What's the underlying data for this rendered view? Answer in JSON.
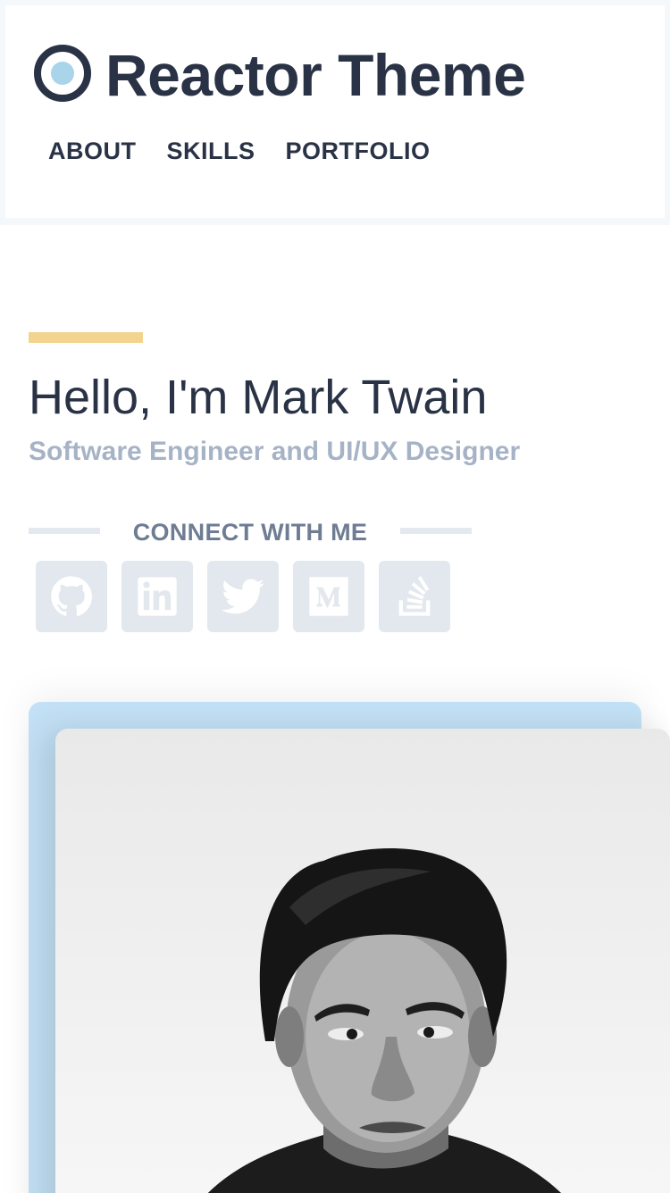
{
  "header": {
    "logo_text": "Reactor Theme",
    "logo_icon": "ring-logo-icon",
    "nav": [
      "ABOUT",
      "SKILLS",
      "PORTFOLIO"
    ]
  },
  "hero": {
    "greeting": "Hello, I'm Mark Twain",
    "subtitle": "Software Engineer and UI/UX Designer",
    "connect_label": "CONNECT WITH ME"
  },
  "socials": [
    {
      "icon": "github-icon"
    },
    {
      "icon": "linkedin-icon"
    },
    {
      "icon": "twitter-icon"
    },
    {
      "icon": "medium-icon"
    },
    {
      "icon": "stackoverflow-icon"
    }
  ],
  "portrait": {
    "image": "black-and-white portrait photo"
  },
  "colors": {
    "primary": "#2a3346",
    "accent": "#f3d48f",
    "logo_dot": "#a9d4ea",
    "subtitle": "#a6b3c6",
    "social_bg": "#e3e8ee",
    "portrait_back": "#c3e1f6"
  }
}
